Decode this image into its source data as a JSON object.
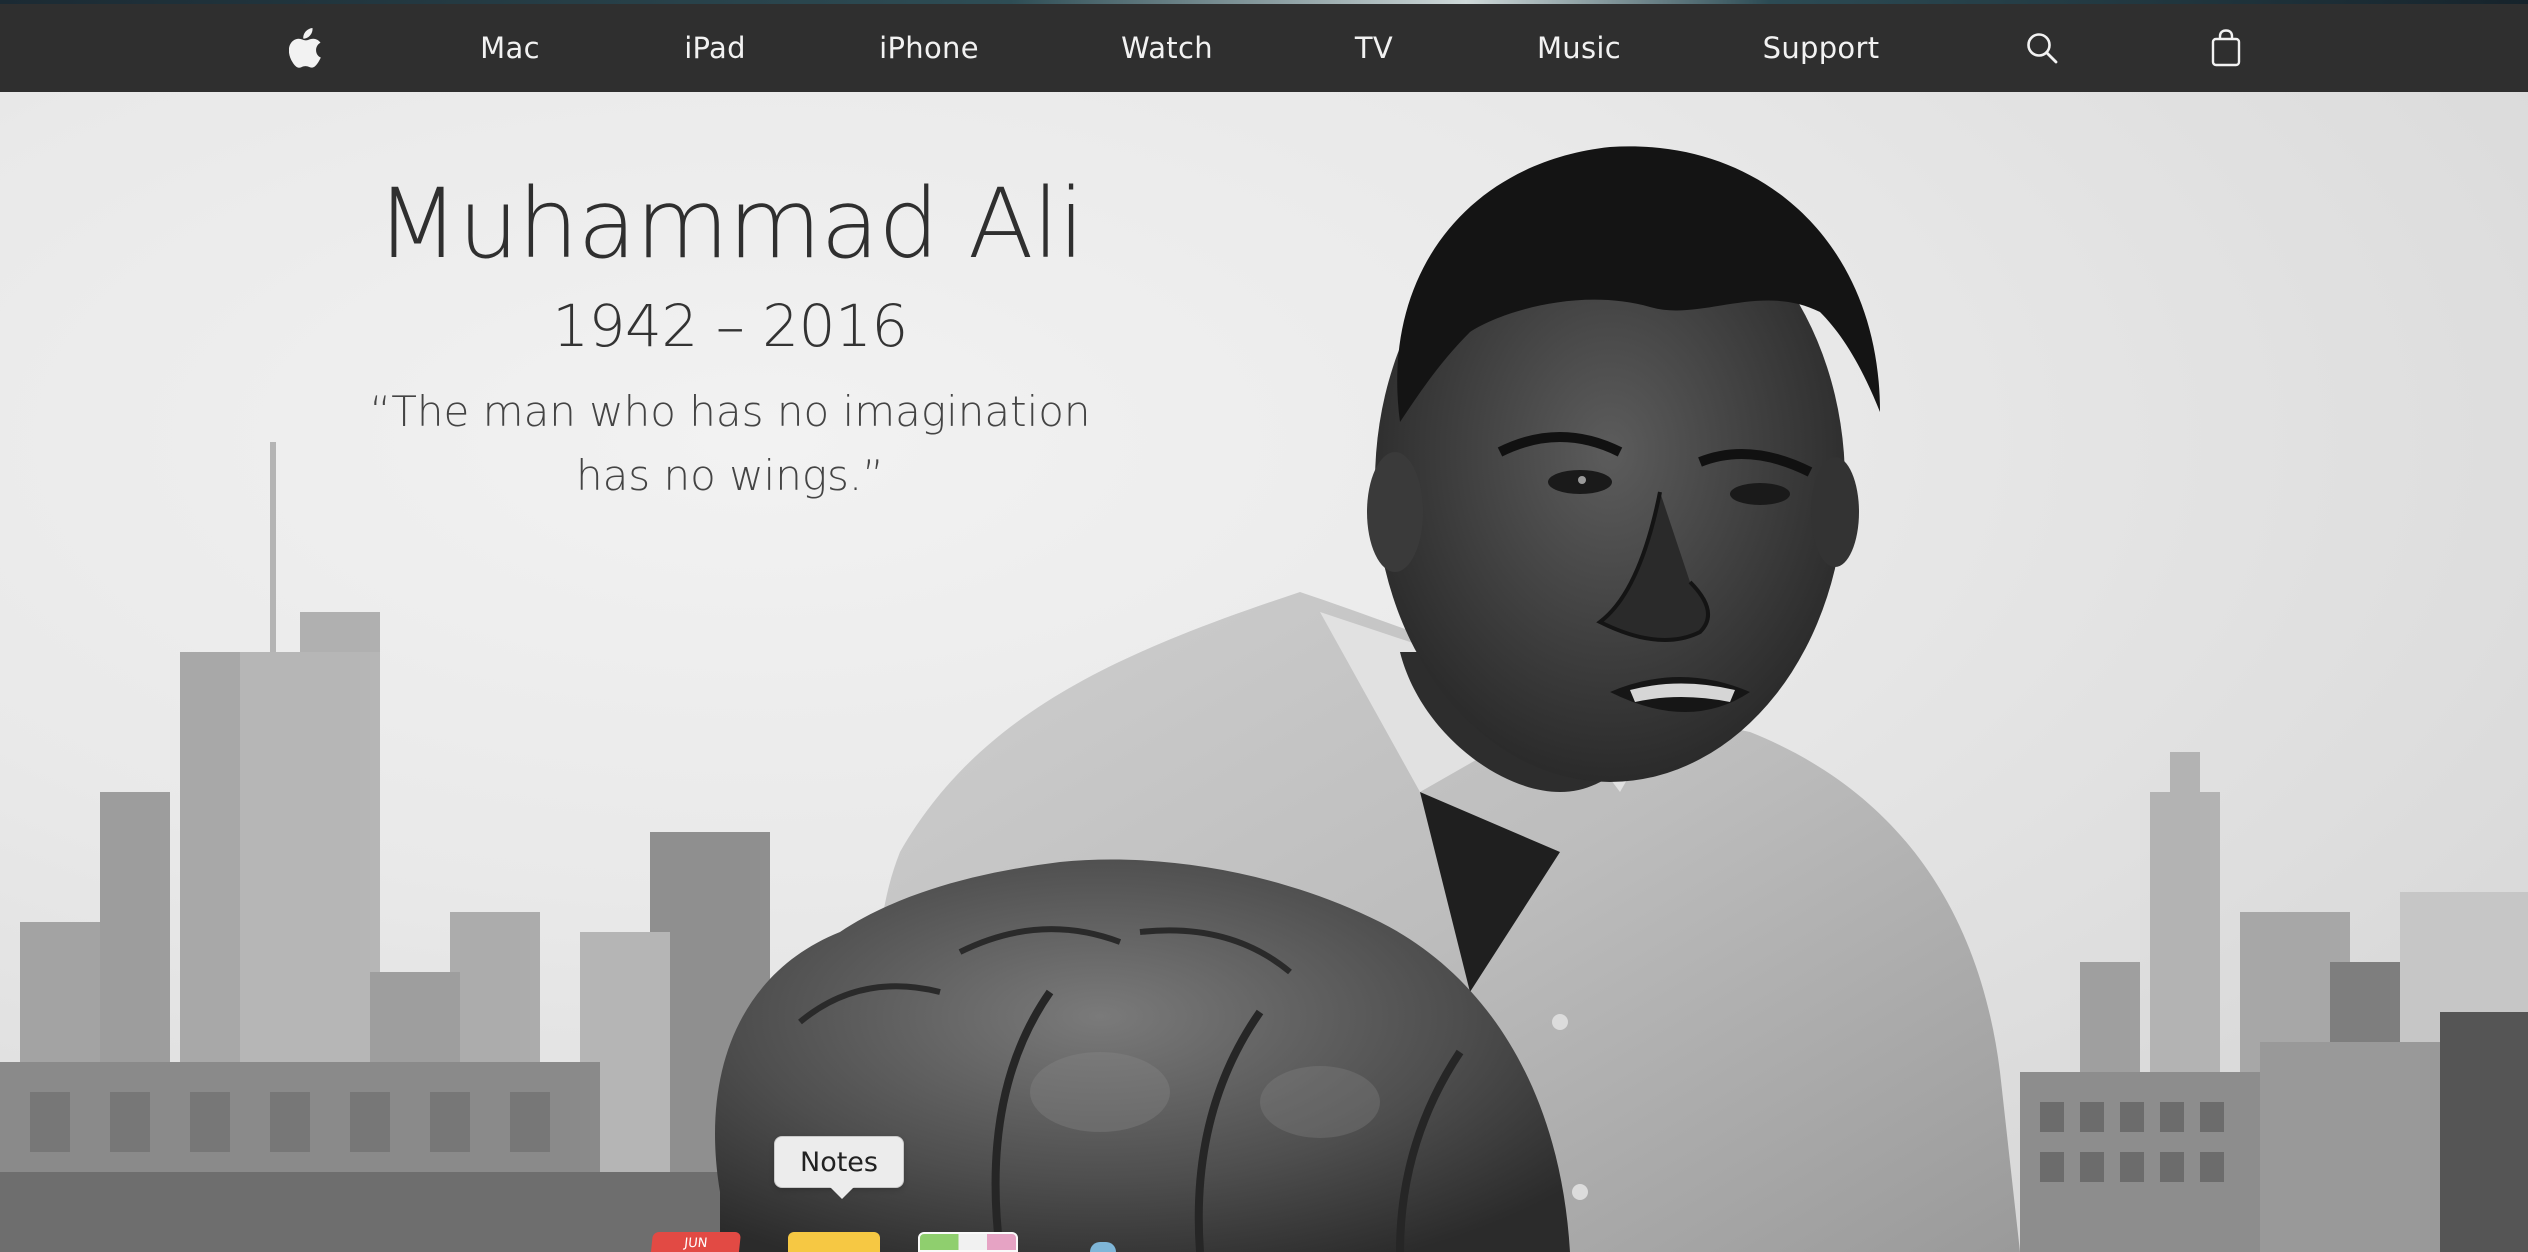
{
  "nav": {
    "apple_logo": "apple-logo-icon",
    "items": [
      "Mac",
      "iPad",
      "iPhone",
      "Watch",
      "TV",
      "Music",
      "Support"
    ],
    "search_icon": "search-icon",
    "bag_icon": "bag-icon"
  },
  "hero": {
    "title": "Muhammad Ali",
    "years": "1942 – 2016",
    "quote_line1": "“The man who has no imagination",
    "quote_line2": "has no wings.”"
  },
  "dock": {
    "tooltip": "Notes",
    "calendar_label": "JUN"
  },
  "colors": {
    "nav_bg": "#2f2f2f",
    "nav_text": "#f2f2f2",
    "hero_text": "#2f2f2f"
  }
}
